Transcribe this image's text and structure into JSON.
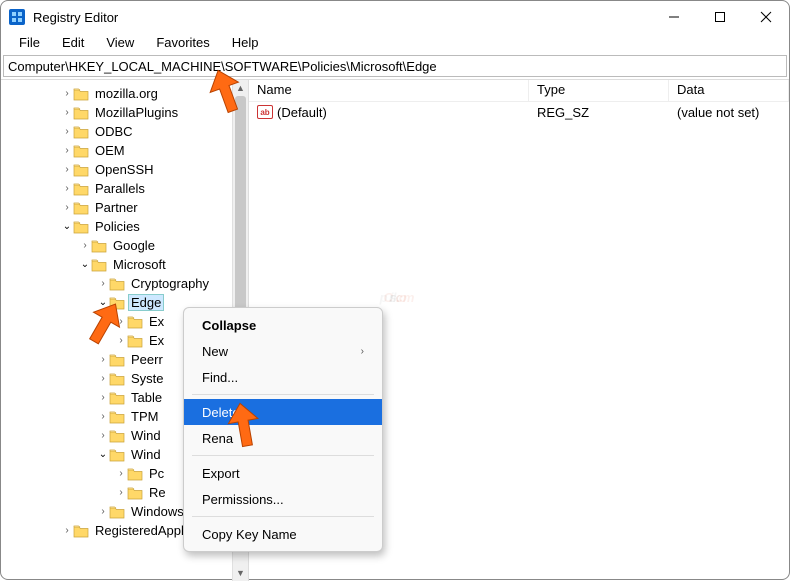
{
  "titlebar": {
    "title": "Registry Editor"
  },
  "menubar": {
    "items": [
      "File",
      "Edit",
      "View",
      "Favorites",
      "Help"
    ]
  },
  "addressbar": {
    "path": "Computer\\HKEY_LOCAL_MACHINE\\SOFTWARE\\Policies\\Microsoft\\Edge"
  },
  "tree": [
    {
      "indent": 3,
      "twisty": ">",
      "label": "mozilla.org"
    },
    {
      "indent": 3,
      "twisty": ">",
      "label": "MozillaPlugins"
    },
    {
      "indent": 3,
      "twisty": ">",
      "label": "ODBC"
    },
    {
      "indent": 3,
      "twisty": ">",
      "label": "OEM"
    },
    {
      "indent": 3,
      "twisty": ">",
      "label": "OpenSSH"
    },
    {
      "indent": 3,
      "twisty": ">",
      "label": "Parallels"
    },
    {
      "indent": 3,
      "twisty": ">",
      "label": "Partner"
    },
    {
      "indent": 3,
      "twisty": "v",
      "label": "Policies"
    },
    {
      "indent": 4,
      "twisty": ">",
      "label": "Google"
    },
    {
      "indent": 4,
      "twisty": "v",
      "label": "Microsoft"
    },
    {
      "indent": 5,
      "twisty": ">",
      "label": "Cryptography"
    },
    {
      "indent": 5,
      "twisty": "v",
      "label": "Edge",
      "selected": true
    },
    {
      "indent": 6,
      "twisty": ">",
      "label": "Ex"
    },
    {
      "indent": 6,
      "twisty": ">",
      "label": "Ex"
    },
    {
      "indent": 5,
      "twisty": ">",
      "label": "Peerr"
    },
    {
      "indent": 5,
      "twisty": ">",
      "label": "Syste"
    },
    {
      "indent": 5,
      "twisty": ">",
      "label": "Table"
    },
    {
      "indent": 5,
      "twisty": ">",
      "label": "TPM"
    },
    {
      "indent": 5,
      "twisty": ">",
      "label": "Wind"
    },
    {
      "indent": 5,
      "twisty": "v",
      "label": "Wind"
    },
    {
      "indent": 6,
      "twisty": ">",
      "label": "Pc"
    },
    {
      "indent": 6,
      "twisty": ">",
      "label": "Re"
    },
    {
      "indent": 5,
      "twisty": ">",
      "label": "Windows NT"
    },
    {
      "indent": 3,
      "twisty": ">",
      "label": "RegisteredApplication"
    }
  ],
  "list": {
    "headers": {
      "name": "Name",
      "type": "Type",
      "data": "Data"
    },
    "rows": [
      {
        "name": "(Default)",
        "type": "REG_SZ",
        "data": "(value not set)"
      }
    ]
  },
  "context_menu": {
    "items": [
      {
        "label": "Collapse",
        "bold": true
      },
      {
        "label": "New",
        "submenu": true
      },
      {
        "label": "Find..."
      },
      {
        "sep": true
      },
      {
        "label": "Delete",
        "highlight": true
      },
      {
        "label": "Rena"
      },
      {
        "sep": true
      },
      {
        "label": "Export"
      },
      {
        "label": "Permissions..."
      },
      {
        "sep": true
      },
      {
        "label": "Copy Key Name"
      }
    ]
  },
  "watermark": {
    "p": "p",
    "c": "C",
    "risk": "risk",
    "com": ".com"
  }
}
